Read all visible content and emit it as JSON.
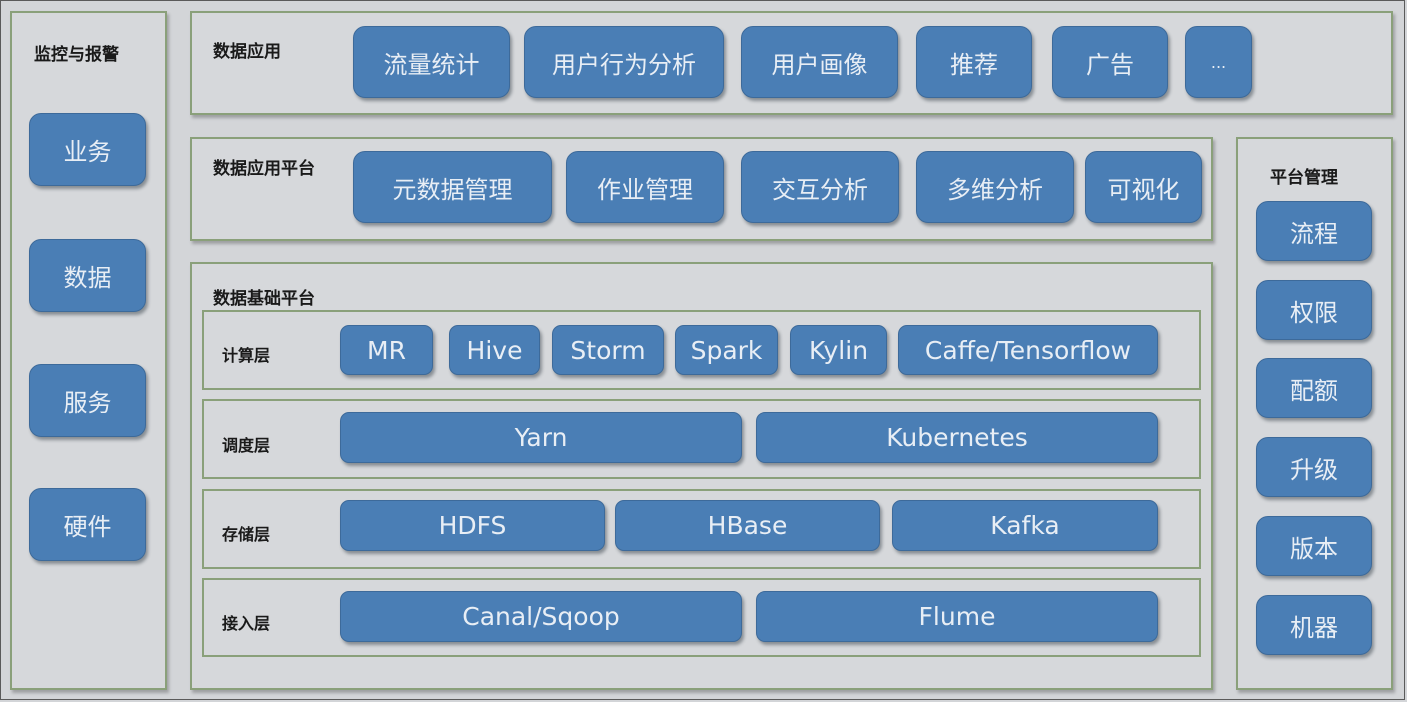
{
  "monitoring": {
    "title": "监控与报警",
    "items": [
      "业务",
      "数据",
      "服务",
      "硬件"
    ]
  },
  "data_applications": {
    "title": "数据应用",
    "items": [
      "流量统计",
      "用户行为分析",
      "用户画像",
      "推荐",
      "广告",
      "..."
    ]
  },
  "data_app_platform": {
    "title": "数据应用平台",
    "items": [
      "元数据管理",
      "作业管理",
      "交互分析",
      "多维分析",
      "可视化"
    ]
  },
  "platform_management": {
    "title": "平台管理",
    "items": [
      "流程",
      "权限",
      "配额",
      "升级",
      "版本",
      "机器"
    ]
  },
  "data_foundation": {
    "title": "数据基础平台",
    "layers": [
      {
        "label": "计算层",
        "items": [
          "MR",
          "Hive",
          "Storm",
          "Spark",
          "Kylin",
          "Caffe/Tensorflow"
        ]
      },
      {
        "label": "调度层",
        "items": [
          "Yarn",
          "Kubernetes"
        ]
      },
      {
        "label": "存储层",
        "items": [
          "HDFS",
          "HBase",
          "Kafka"
        ]
      },
      {
        "label": "接入层",
        "items": [
          "Canal/Sqoop",
          "Flume"
        ]
      }
    ]
  },
  "colors": {
    "box_fill": "#4a7eb5",
    "panel_border": "#8aa07a",
    "background": "#d3d5d8"
  }
}
